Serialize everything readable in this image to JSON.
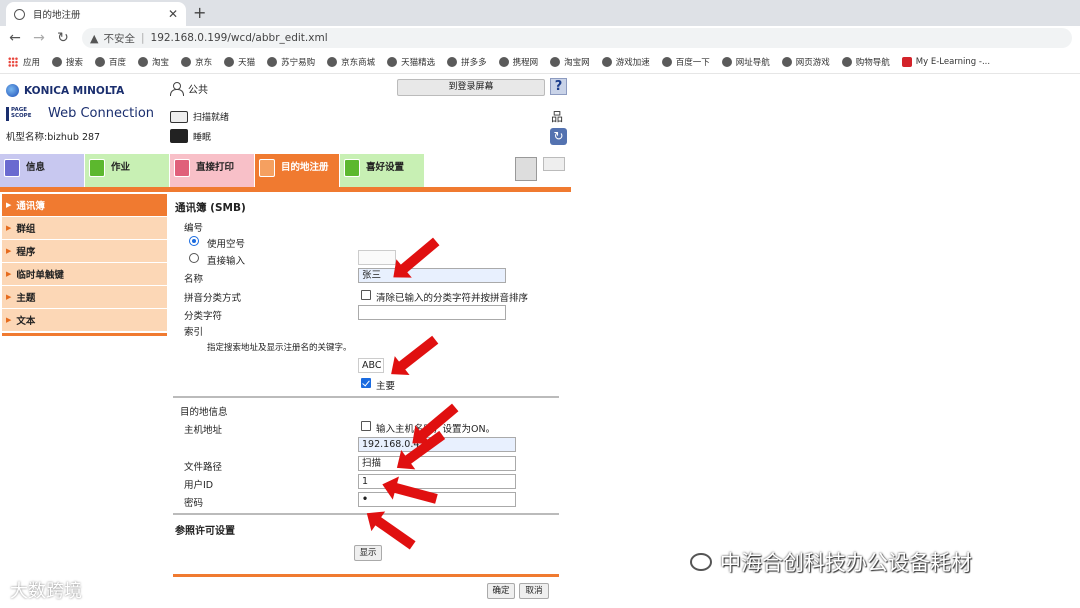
{
  "browser": {
    "tab_title": "目的地注册",
    "new_tab": "+",
    "insecure_label": "不安全",
    "separator": "|",
    "url": "192.168.0.199/wcd/abbr_edit.xml",
    "bookmarks": [
      "应用",
      "搜索",
      "百度",
      "淘宝",
      "京东",
      "天猫",
      "苏宁易购",
      "京东商城",
      "天猫精选",
      "拼多多",
      "携程网",
      "淘宝网",
      "游戏加速",
      "百度一下",
      "网址导航",
      "网页游戏",
      "购物导航",
      "My E-Learning -..."
    ]
  },
  "header": {
    "brand": "KONICA MINOLTA",
    "pagescope": "PAGE SCOPE",
    "web_connection": "Web Connection",
    "model": "机型名称:bizhub 287",
    "user": "公共",
    "login_button": "到登录屏幕",
    "help": "?",
    "scan_status": "扫描就绪",
    "print_status": "睡眠"
  },
  "main_tabs": [
    {
      "label": "信息",
      "color": "#c8c8f0"
    },
    {
      "label": "作业",
      "color": "#c8f0b4"
    },
    {
      "label": "直接打印",
      "color": "#f8c0c8"
    },
    {
      "label": "目的地注册",
      "color": "#f07a30"
    },
    {
      "label": "喜好设置",
      "color": "#c8f0b4"
    }
  ],
  "sidebar": {
    "items": [
      {
        "label": "通讯簿",
        "active": true
      },
      {
        "label": "群组",
        "active": false
      },
      {
        "label": "程序",
        "active": false
      },
      {
        "label": "临时单触键",
        "active": false
      },
      {
        "label": "主题",
        "active": false
      },
      {
        "label": "文本",
        "active": false
      }
    ]
  },
  "form": {
    "title": "通讯簿 (SMB)",
    "number_label": "编号",
    "use_empty": "使用空号",
    "direct_input": "直接输入",
    "name_label": "名称",
    "name_value": "张三",
    "pinyin_label": "拼音分类方式",
    "pinyin_checkbox": "清除已输入的分类字符并按拼音排序",
    "sort_char_label": "分类字符",
    "index_label": "索引",
    "index_hint": "指定搜索地址及显示注册名的关键字。",
    "index_value": "ABC",
    "main_checkbox": "主要",
    "dest_info": "目的地信息",
    "host_label": "主机地址",
    "host_checkbox": "输入主机名时，设置为ON。",
    "host_value": "192.168.0.4",
    "path_label": "文件路径",
    "path_value": "扫描",
    "userid_label": "用户ID",
    "userid_value": "1",
    "password_label": "密码",
    "password_value": "•",
    "ref_title": "参照许可设置",
    "show_button": "显示",
    "ok_button": "确定",
    "cancel_button": "取消"
  },
  "watermarks": {
    "wechat": "中海合创科技办公设备耗材",
    "corner": "大数跨境"
  }
}
